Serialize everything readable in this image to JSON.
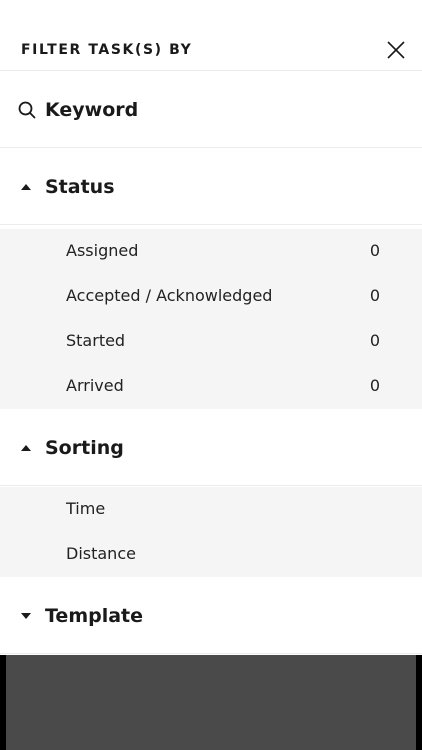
{
  "header": {
    "title": "FILTER TASK(S) BY",
    "close_icon": "close-icon"
  },
  "keyword": {
    "label": "Keyword",
    "icon": "search-icon"
  },
  "status": {
    "title": "Status",
    "expanded": true,
    "items": [
      {
        "label": "Assigned",
        "count": "0"
      },
      {
        "label": "Accepted / Acknowledged",
        "count": "0"
      },
      {
        "label": "Started",
        "count": "0"
      },
      {
        "label": "Arrived",
        "count": "0"
      }
    ]
  },
  "sorting": {
    "title": "Sorting",
    "expanded": true,
    "items": [
      {
        "label": "Time"
      },
      {
        "label": "Distance"
      }
    ]
  },
  "template": {
    "title": "Template",
    "expanded": false
  },
  "colors": {
    "list_background": "#f5f5f5",
    "divider": "#ececec",
    "overlay": "#4a4a4a"
  }
}
